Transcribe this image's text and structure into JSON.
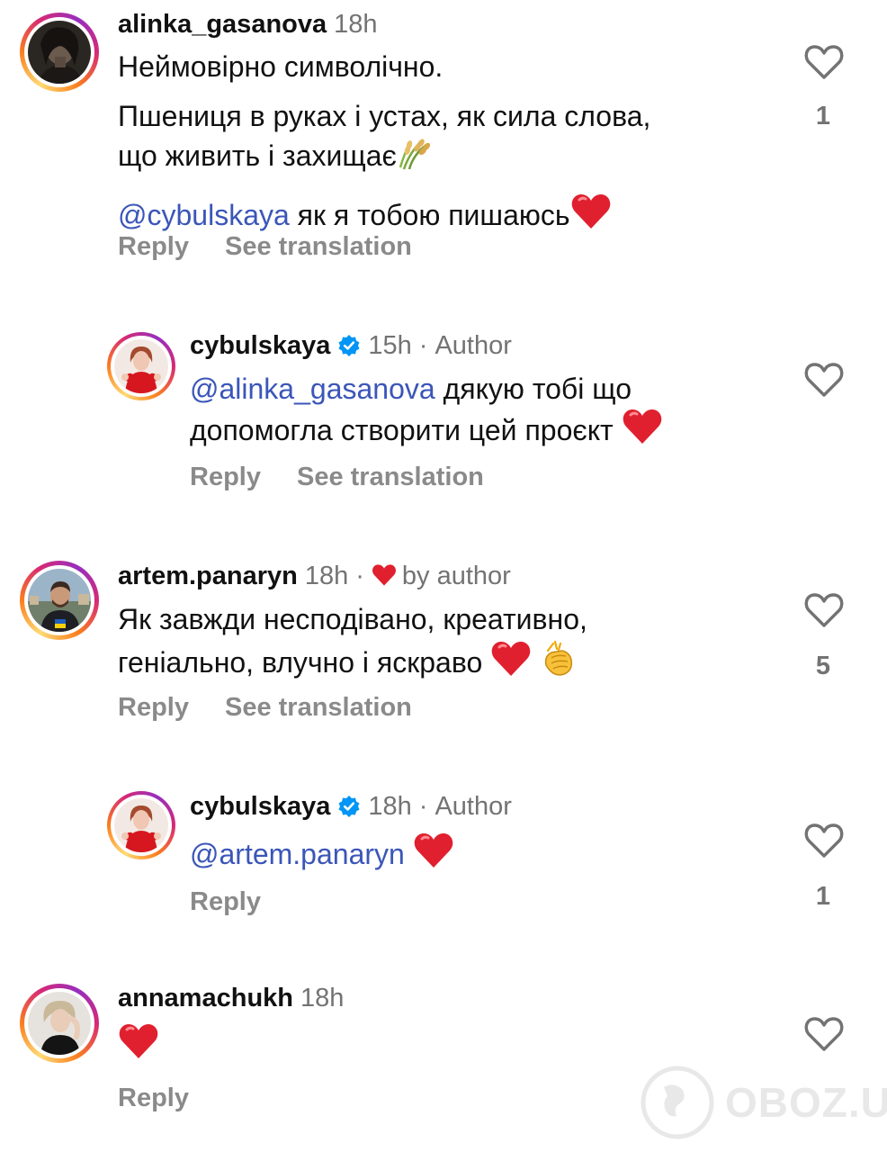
{
  "comments": [
    {
      "username": "alinka_gasanova",
      "time": "18h",
      "lines": [
        "Неймовірно символічно.",
        "Пшениця в руках і устах, як сила слова,",
        "що живить і захищає"
      ],
      "mention": "@cybulskaya",
      "mention_text": " як я тобою пишаюсь",
      "reply_label": "Reply",
      "translate_label": "See translation",
      "likes": "1"
    },
    {
      "username": "cybulskaya",
      "time": "15h",
      "author_label": "Author",
      "mention": "@alinka_gasanova",
      "line1_rest": " дякую тобі що",
      "line2": "допомогла створити цей проєкт ",
      "reply_label": "Reply",
      "translate_label": "See translation"
    },
    {
      "username": "artem.panaryn",
      "time": "18h",
      "liked_label": "by author",
      "line1": "Як завжди несподівано, креативно,",
      "line2": "геніально, влучно і яскраво ",
      "reply_label": "Reply",
      "translate_label": "See translation",
      "likes": "5"
    },
    {
      "username": "cybulskaya",
      "time": "18h",
      "author_label": "Author",
      "mention": "@artem.panaryn",
      "reply_label": "Reply",
      "likes": "1"
    },
    {
      "username": "annamachukh",
      "time": "18h",
      "reply_label": "Reply"
    }
  ],
  "icons": {
    "like": "heart-outline-icon",
    "verified": "verified-badge-icon",
    "heart_emoji": "red-heart-emoji",
    "wheat_emoji": "sheaf-of-rice-emoji",
    "clap_emoji": "clapping-hands-emoji"
  },
  "colors": {
    "mention": "#3b56b8",
    "secondary_text": "#737373",
    "verified": "#0095f6",
    "heart": "#e0202f"
  },
  "watermark": {
    "text": "OBOZ.UA"
  }
}
